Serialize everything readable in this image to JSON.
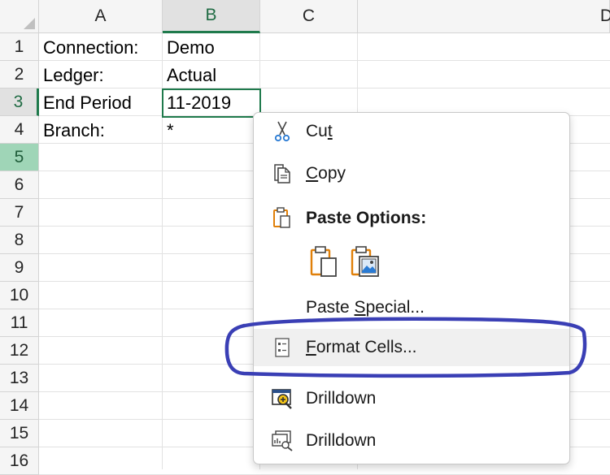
{
  "columns": [
    "A",
    "B",
    "C",
    "D"
  ],
  "rows": [
    "1",
    "2",
    "3",
    "4",
    "5",
    "6",
    "7",
    "8",
    "9",
    "10",
    "11",
    "12",
    "13",
    "14",
    "15",
    "16"
  ],
  "cells": [
    {
      "a": "Connection:",
      "b": "Demo"
    },
    {
      "a": "Ledger:",
      "b": "Actual"
    },
    {
      "a": "End Period",
      "b": "11-2019"
    },
    {
      "a": "Branch:",
      "b": "*"
    }
  ],
  "context_menu": {
    "cut": {
      "pre": "Cu",
      "key": "t",
      "post": ""
    },
    "copy": {
      "pre": "",
      "key": "C",
      "post": "opy"
    },
    "paste_options": "Paste Options:",
    "paste_special": {
      "pre": "Paste ",
      "key": "S",
      "post": "pecial..."
    },
    "format_cells": {
      "pre": "",
      "key": "F",
      "post": "ormat Cells..."
    },
    "drilldown_1": "Drilldown",
    "drilldown_2": "Drilldown"
  },
  "colors": {
    "selection_green": "#1f7a4c",
    "highlight_row": "#9fd5b7",
    "annotation_stroke": "#3a3fb5",
    "paste_icon_orange": "#e0800a"
  },
  "icons": [
    "scissors-icon",
    "copy-icon",
    "paste-icon",
    "paste-default-icon",
    "paste-picture-icon",
    "format-cells-icon",
    "drilldown-zoom-icon",
    "drilldown-chart-icon"
  ]
}
